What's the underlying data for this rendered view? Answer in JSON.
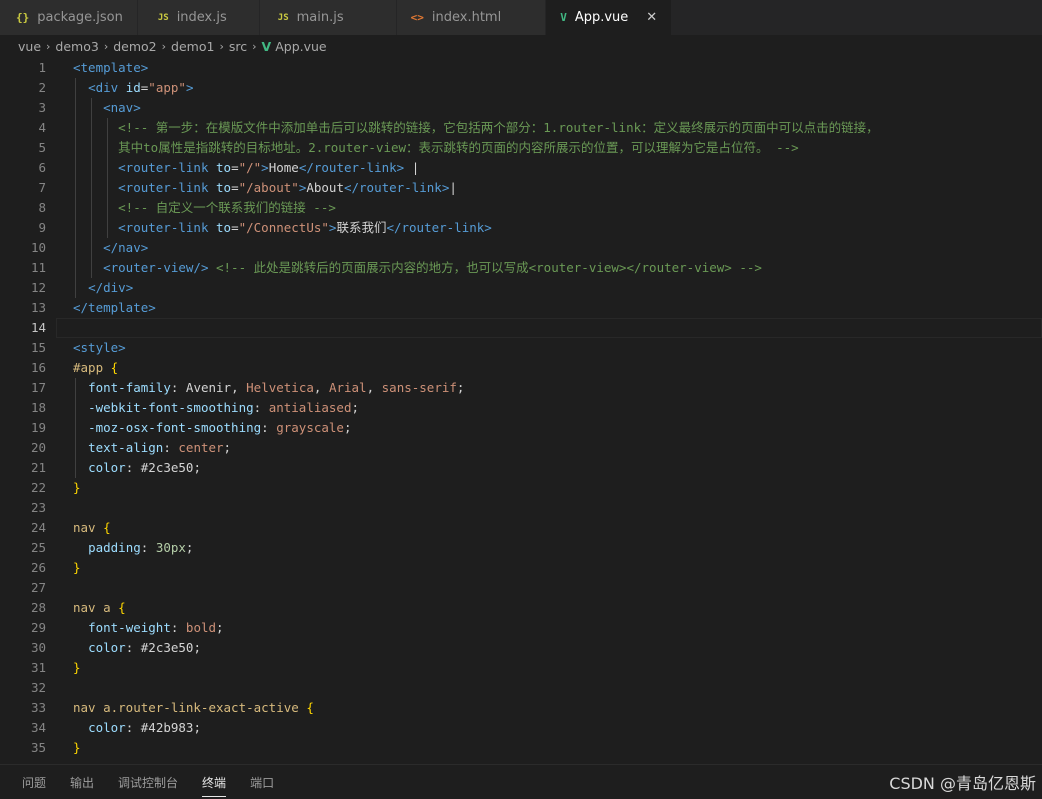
{
  "tabs": [
    {
      "icon": "{}",
      "icon_name": "json-icon",
      "label": "package.json"
    },
    {
      "icon": "JS",
      "icon_name": "javascript-icon",
      "label": "index.js"
    },
    {
      "icon": "JS",
      "icon_name": "javascript-icon",
      "label": "main.js"
    },
    {
      "icon": "<>",
      "icon_name": "html-icon",
      "label": "index.html"
    },
    {
      "icon": "V",
      "icon_name": "vue-icon",
      "label": "App.vue",
      "active": true,
      "close": "✕"
    }
  ],
  "breadcrumb": {
    "parts": [
      "vue",
      "demo3",
      "demo2",
      "demo1",
      "src"
    ],
    "file": "App.vue",
    "separator": "›"
  },
  "editor": {
    "current_line": 14,
    "lines": [
      {
        "n": 1,
        "tokens": [
          [
            "t-tag",
            "<template>"
          ]
        ]
      },
      {
        "n": 2,
        "tokens": [
          [
            "t-txt",
            "  "
          ],
          [
            "t-tag",
            "<div "
          ],
          [
            "t-attr",
            "id"
          ],
          [
            "t-txt",
            "="
          ],
          [
            "t-str",
            "\"app\""
          ],
          [
            "t-tag",
            ">"
          ]
        ]
      },
      {
        "n": 3,
        "tokens": [
          [
            "t-txt",
            "    "
          ],
          [
            "t-tag",
            "<nav>"
          ]
        ]
      },
      {
        "n": 4,
        "tokens": [
          [
            "t-txt",
            "      "
          ],
          [
            "t-com",
            "<!-- 第一步：在模版文件中添加单击后可以跳转的链接，它包括两个部分：1.router-link：定义最终展示的页面中可以点击的链接，"
          ]
        ]
      },
      {
        "n": 5,
        "tokens": [
          [
            "t-txt",
            "      "
          ],
          [
            "t-com",
            "其中to属性是指跳转的目标地址。2.router-view：表示跳转的页面的内容所展示的位置，可以理解为它是占位符。 -->"
          ]
        ]
      },
      {
        "n": 6,
        "tokens": [
          [
            "t-txt",
            "      "
          ],
          [
            "t-tag",
            "<router-link "
          ],
          [
            "t-attr",
            "to"
          ],
          [
            "t-txt",
            "="
          ],
          [
            "t-str",
            "\"/\""
          ],
          [
            "t-tag",
            ">"
          ],
          [
            "t-txt",
            "Home"
          ],
          [
            "t-tag",
            "</router-link>"
          ],
          [
            "t-txt",
            " |"
          ]
        ]
      },
      {
        "n": 7,
        "tokens": [
          [
            "t-txt",
            "      "
          ],
          [
            "t-tag",
            "<router-link "
          ],
          [
            "t-attr",
            "to"
          ],
          [
            "t-txt",
            "="
          ],
          [
            "t-str",
            "\"/about\""
          ],
          [
            "t-tag",
            ">"
          ],
          [
            "t-txt",
            "About"
          ],
          [
            "t-tag",
            "</router-link>"
          ],
          [
            "t-txt",
            "|"
          ]
        ]
      },
      {
        "n": 8,
        "tokens": [
          [
            "t-txt",
            "      "
          ],
          [
            "t-com",
            "<!-- 自定义一个联系我们的链接 -->"
          ]
        ]
      },
      {
        "n": 9,
        "tokens": [
          [
            "t-txt",
            "      "
          ],
          [
            "t-tag",
            "<router-link "
          ],
          [
            "t-attr",
            "to"
          ],
          [
            "t-txt",
            "="
          ],
          [
            "t-str",
            "\"/ConnectUs\""
          ],
          [
            "t-tag",
            ">"
          ],
          [
            "t-txt",
            "联系我们"
          ],
          [
            "t-tag",
            "</router-link>"
          ]
        ]
      },
      {
        "n": 10,
        "tokens": [
          [
            "t-txt",
            "    "
          ],
          [
            "t-tag",
            "</nav>"
          ]
        ]
      },
      {
        "n": 11,
        "tokens": [
          [
            "t-txt",
            "    "
          ],
          [
            "t-tag",
            "<router-view/>"
          ],
          [
            "t-txt",
            " "
          ],
          [
            "t-com",
            "<!-- 此处是跳转后的页面展示内容的地方，也可以写成<router-view></router-view> -->"
          ]
        ]
      },
      {
        "n": 12,
        "tokens": [
          [
            "t-txt",
            "  "
          ],
          [
            "t-tag",
            "</div>"
          ]
        ]
      },
      {
        "n": 13,
        "tokens": [
          [
            "t-tag",
            "</template>"
          ]
        ]
      },
      {
        "n": 14,
        "tokens": []
      },
      {
        "n": 15,
        "tokens": [
          [
            "t-tag",
            "<style>"
          ]
        ]
      },
      {
        "n": 16,
        "tokens": [
          [
            "t-sel",
            "#app"
          ],
          [
            "t-txt",
            " "
          ],
          [
            "t-brace",
            "{"
          ]
        ]
      },
      {
        "n": 17,
        "tokens": [
          [
            "t-txt",
            "  "
          ],
          [
            "t-prop",
            "font-family"
          ],
          [
            "t-pun",
            ": "
          ],
          [
            "t-txt",
            "Avenir"
          ],
          [
            "t-pun",
            ", "
          ],
          [
            "t-val",
            "Helvetica"
          ],
          [
            "t-pun",
            ", "
          ],
          [
            "t-val",
            "Arial"
          ],
          [
            "t-pun",
            ", "
          ],
          [
            "t-val",
            "sans-serif"
          ],
          [
            "t-pun",
            ";"
          ]
        ]
      },
      {
        "n": 18,
        "tokens": [
          [
            "t-txt",
            "  "
          ],
          [
            "t-prop",
            "-webkit-font-smoothing"
          ],
          [
            "t-pun",
            ": "
          ],
          [
            "t-val",
            "antialiased"
          ],
          [
            "t-pun",
            ";"
          ]
        ]
      },
      {
        "n": 19,
        "tokens": [
          [
            "t-txt",
            "  "
          ],
          [
            "t-prop",
            "-moz-osx-font-smoothing"
          ],
          [
            "t-pun",
            ": "
          ],
          [
            "t-val",
            "grayscale"
          ],
          [
            "t-pun",
            ";"
          ]
        ]
      },
      {
        "n": 20,
        "tokens": [
          [
            "t-txt",
            "  "
          ],
          [
            "t-prop",
            "text-align"
          ],
          [
            "t-pun",
            ": "
          ],
          [
            "t-val",
            "center"
          ],
          [
            "t-pun",
            ";"
          ]
        ]
      },
      {
        "n": 21,
        "tokens": [
          [
            "t-txt",
            "  "
          ],
          [
            "t-prop",
            "color"
          ],
          [
            "t-pun",
            ": "
          ],
          [
            "t-txt",
            "#2c3e50"
          ],
          [
            "t-pun",
            ";"
          ]
        ]
      },
      {
        "n": 22,
        "tokens": [
          [
            "t-brace",
            "}"
          ]
        ]
      },
      {
        "n": 23,
        "tokens": []
      },
      {
        "n": 24,
        "tokens": [
          [
            "t-sel",
            "nav"
          ],
          [
            "t-txt",
            " "
          ],
          [
            "t-brace",
            "{"
          ]
        ]
      },
      {
        "n": 25,
        "tokens": [
          [
            "t-txt",
            "  "
          ],
          [
            "t-prop",
            "padding"
          ],
          [
            "t-pun",
            ": "
          ],
          [
            "t-num",
            "30px"
          ],
          [
            "t-pun",
            ";"
          ]
        ]
      },
      {
        "n": 26,
        "tokens": [
          [
            "t-brace",
            "}"
          ]
        ]
      },
      {
        "n": 27,
        "tokens": []
      },
      {
        "n": 28,
        "tokens": [
          [
            "t-sel",
            "nav a"
          ],
          [
            "t-txt",
            " "
          ],
          [
            "t-brace",
            "{"
          ]
        ]
      },
      {
        "n": 29,
        "tokens": [
          [
            "t-txt",
            "  "
          ],
          [
            "t-prop",
            "font-weight"
          ],
          [
            "t-pun",
            ": "
          ],
          [
            "t-val",
            "bold"
          ],
          [
            "t-pun",
            ";"
          ]
        ]
      },
      {
        "n": 30,
        "tokens": [
          [
            "t-txt",
            "  "
          ],
          [
            "t-prop",
            "color"
          ],
          [
            "t-pun",
            ": "
          ],
          [
            "t-txt",
            "#2c3e50"
          ],
          [
            "t-pun",
            ";"
          ]
        ]
      },
      {
        "n": 31,
        "tokens": [
          [
            "t-brace",
            "}"
          ]
        ]
      },
      {
        "n": 32,
        "tokens": []
      },
      {
        "n": 33,
        "tokens": [
          [
            "t-sel",
            "nav a.router-link-exact-active"
          ],
          [
            "t-txt",
            " "
          ],
          [
            "t-brace",
            "{"
          ]
        ]
      },
      {
        "n": 34,
        "tokens": [
          [
            "t-txt",
            "  "
          ],
          [
            "t-prop",
            "color"
          ],
          [
            "t-pun",
            ": "
          ],
          [
            "t-txt",
            "#42b983"
          ],
          [
            "t-pun",
            ";"
          ]
        ]
      },
      {
        "n": 35,
        "tokens": [
          [
            "t-brace",
            "}"
          ]
        ]
      }
    ]
  },
  "panel": {
    "tabs": [
      {
        "label": "问题",
        "name": "panel-tab-problems"
      },
      {
        "label": "输出",
        "name": "panel-tab-output"
      },
      {
        "label": "调试控制台",
        "name": "panel-tab-debug-console"
      },
      {
        "label": "终端",
        "name": "panel-tab-terminal",
        "active": true
      },
      {
        "label": "端口",
        "name": "panel-tab-ports"
      }
    ]
  },
  "watermark": "CSDN @青岛亿恩斯",
  "colors": {
    "tag": "#569cd6",
    "attribute": "#9cdcfe",
    "string": "#ce9178",
    "comment": "#6a9955",
    "selector": "#d7ba7d",
    "brace": "#ffd700",
    "vue_green": "#41b883",
    "js_yellow": "#cbcb41"
  }
}
